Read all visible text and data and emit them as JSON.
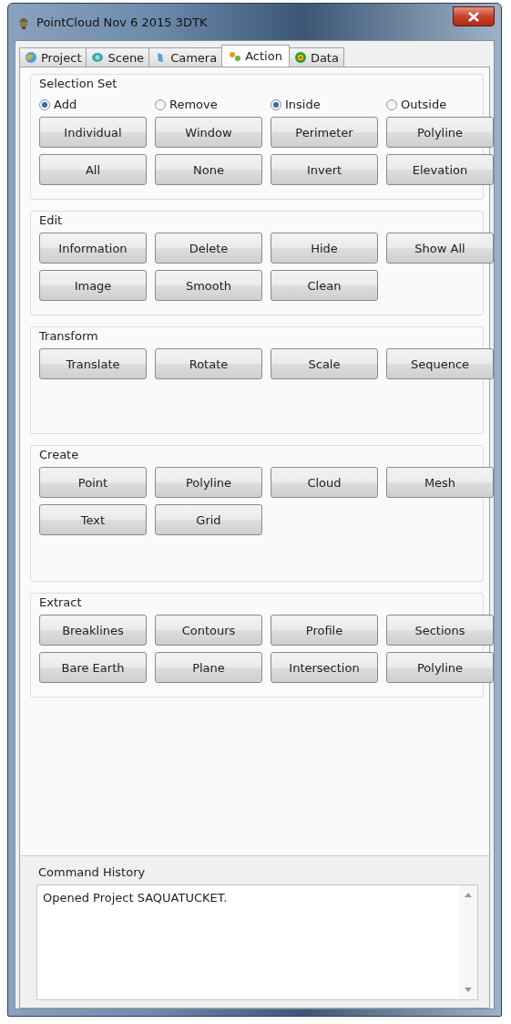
{
  "window": {
    "title": "PointCloud Nov  6 2015 3DTK"
  },
  "tabs": [
    {
      "label": "Project",
      "selected": false
    },
    {
      "label": "Scene",
      "selected": false
    },
    {
      "label": "Camera",
      "selected": false
    },
    {
      "label": "Action",
      "selected": true
    },
    {
      "label": "Data",
      "selected": false
    }
  ],
  "groups": [
    {
      "title": "Selection Set",
      "radios": [
        {
          "label": "Add",
          "selected": true
        },
        {
          "label": "Remove",
          "selected": false
        },
        {
          "label": "Inside",
          "selected": true
        },
        {
          "label": "Outside",
          "selected": false
        }
      ],
      "buttons": [
        [
          "Individual",
          "Window",
          "Perimeter",
          "Polyline"
        ],
        [
          "All",
          "None",
          "Invert",
          "Elevation"
        ]
      ]
    },
    {
      "title": "Edit",
      "buttons": [
        [
          "Information",
          "Delete",
          "Hide",
          "Show All"
        ],
        [
          "Image",
          "Smooth",
          "Clean"
        ]
      ]
    },
    {
      "title": "Transform",
      "buttons": [
        [
          "Translate",
          "Rotate",
          "Scale",
          "Sequence"
        ]
      ]
    },
    {
      "title": "Create",
      "buttons": [
        [
          "Point",
          "Polyline",
          "Cloud",
          "Mesh"
        ],
        [
          "Text",
          "Grid"
        ]
      ]
    },
    {
      "title": "Extract",
      "buttons": [
        [
          "Breaklines",
          "Contours",
          "Profile",
          "Sections"
        ],
        [
          "Bare Earth",
          "Plane",
          "Intersection",
          "Polyline"
        ]
      ]
    }
  ],
  "command_history": {
    "title": "Command History",
    "lines": [
      "Opened Project SAQUATUCKET."
    ]
  }
}
